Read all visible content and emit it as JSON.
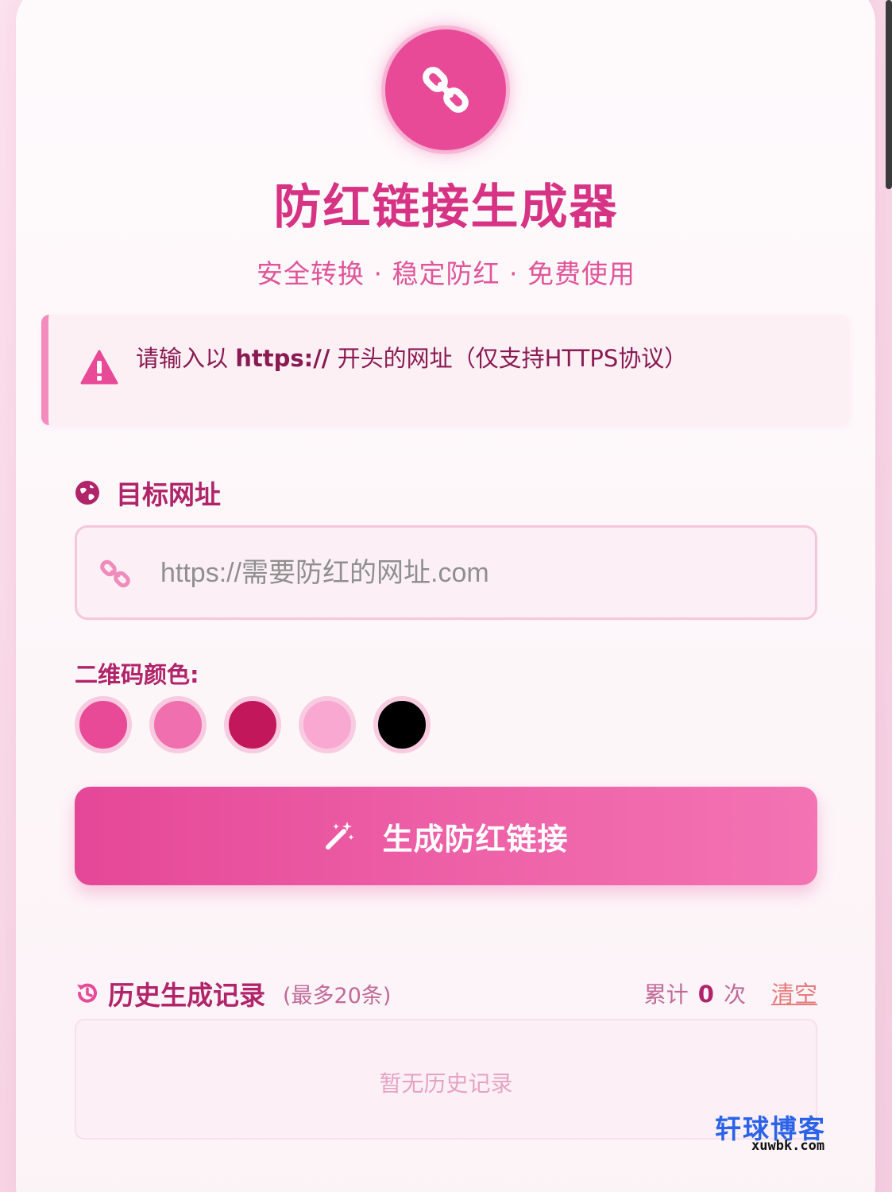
{
  "header": {
    "logo_icon": "link-icon",
    "title": "防红链接生成器",
    "subtitle": "安全转换 · 稳定防红 · 免费使用"
  },
  "notice": {
    "icon": "warning-icon",
    "text_before": "请输入以 ",
    "text_bold": "https://",
    "text_after": " 开头的网址（仅支持HTTPS协议）"
  },
  "target": {
    "icon": "globe-icon",
    "label": "目标网址",
    "input_icon": "link-icon",
    "placeholder": "https://需要防红的网址.com",
    "value": ""
  },
  "qr_color": {
    "label": "二维码颜色:",
    "options": [
      "#e84a98",
      "#f06fae",
      "#c2185b",
      "#f9a8d1",
      "#000000"
    ]
  },
  "generate_button": {
    "icon": "magic-wand-icon",
    "label": "生成防红链接"
  },
  "history": {
    "icon": "history-icon",
    "title": "历史生成记录",
    "note": "(最多20条)",
    "count_prefix": "累计",
    "count_value": "0",
    "count_suffix": "次",
    "clear_label": "清空",
    "empty_text": "暂无历史记录"
  },
  "watermark": {
    "cn": "轩球博客",
    "en": "xuwbk.com"
  },
  "colors": {
    "accent": "#e84a98",
    "title": "#d63384",
    "label": "#b0246a"
  }
}
